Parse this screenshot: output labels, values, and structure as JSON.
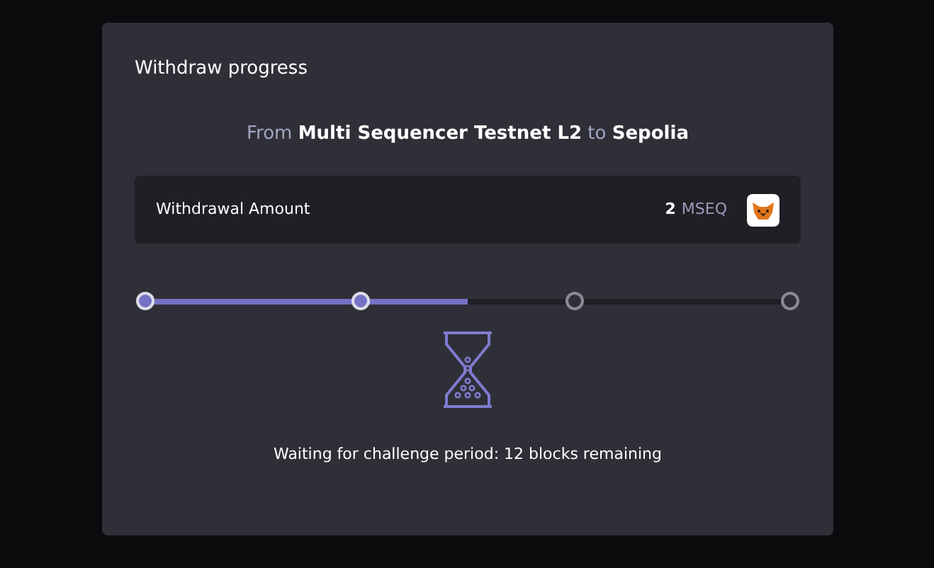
{
  "card": {
    "title": "Withdraw progress",
    "route": "From **Multi Sequencer Testnet L2** to **Sepolia**",
    "amount": {
      "label": "Withdrawal Amount",
      "value": "2",
      "unit": "MSEQ"
    },
    "progress": {
      "level": 0.5,
      "steps": [
        {
          "reached": true
        },
        {
          "reached": true
        },
        {
          "reached": false
        },
        {
          "reached": false
        }
      ]
    },
    "status": "Waiting for challenge period: 12 blocks remaining"
  }
}
